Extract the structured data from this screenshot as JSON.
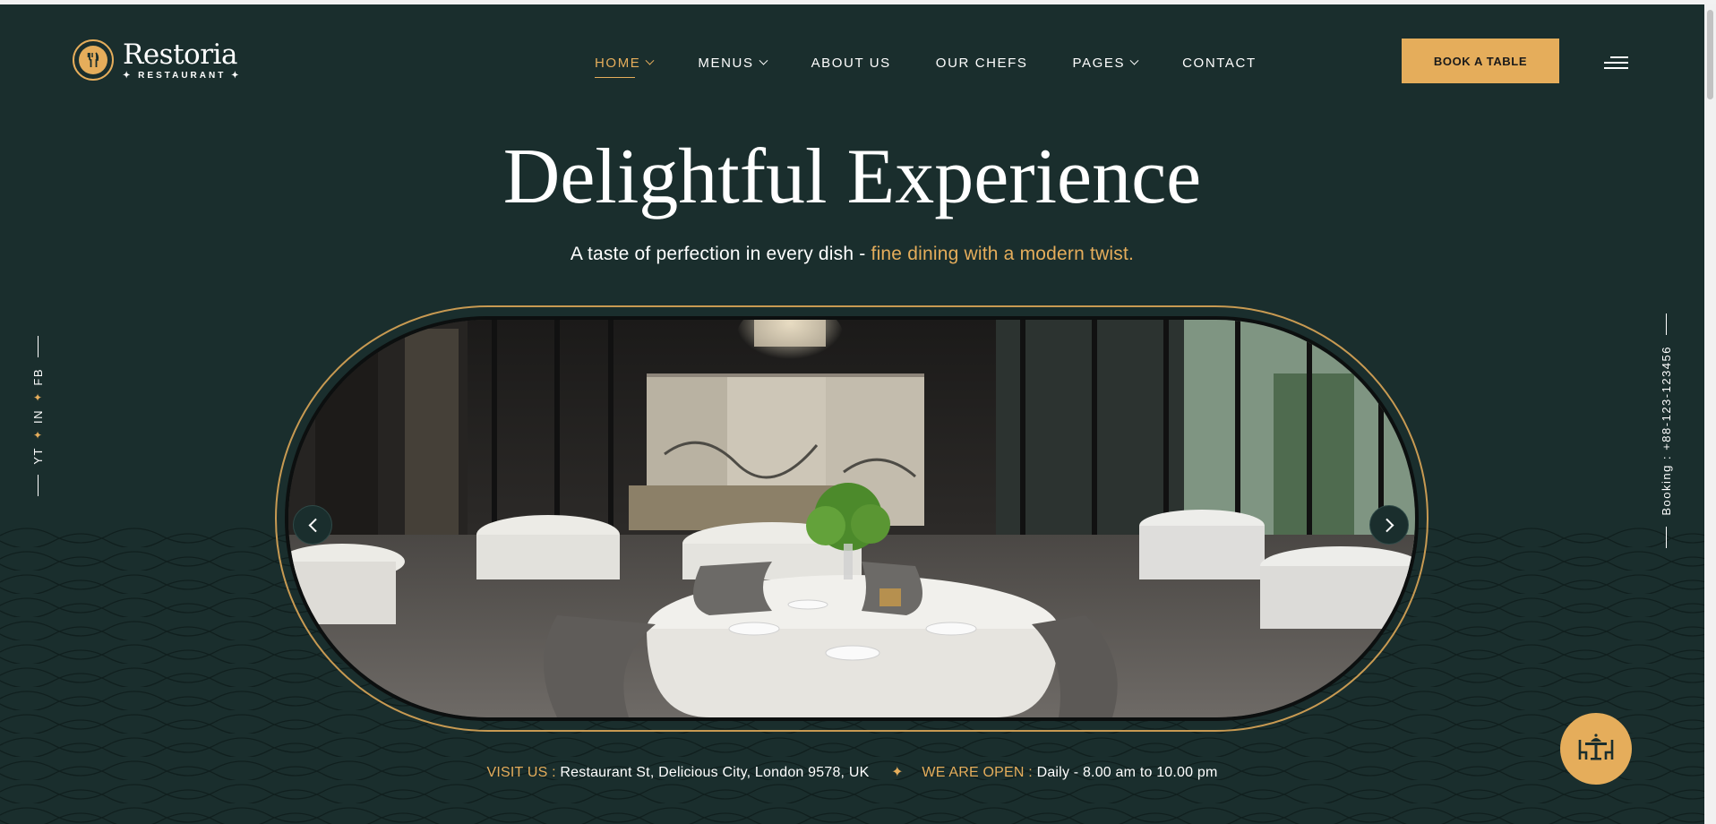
{
  "brand": {
    "name": "Restoria",
    "tagline": "RESTAURANT",
    "icon": "fork-knife-icon",
    "accent_color": "#e5ad5b",
    "background_color": "#1a2e2d"
  },
  "nav": {
    "items": [
      {
        "label": "HOME",
        "has_dropdown": true,
        "active": true
      },
      {
        "label": "MENUS",
        "has_dropdown": true
      },
      {
        "label": "ABOUT US"
      },
      {
        "label": "OUR CHEFS"
      },
      {
        "label": "PAGES",
        "has_dropdown": true
      },
      {
        "label": "CONTACT"
      }
    ],
    "cta": "BOOK A TABLE",
    "menu_icon": "hamburger-icon"
  },
  "hero": {
    "title": "Delightful Experience",
    "subtitle_plain": "A taste of perfection in every dish -",
    "subtitle_accent": "fine dining with a modern twist.",
    "image": "restaurant-dining-room-photo",
    "prev_icon": "chevron-left-icon",
    "next_icon": "chevron-right-icon"
  },
  "social": {
    "links": [
      "FB",
      "IN",
      "YT"
    ]
  },
  "booking": {
    "text": "Booking : +88-123-123456"
  },
  "info": {
    "visit_label": "VISIT US :",
    "visit_value": "Restaurant St, Delicious City, London 9578, UK",
    "open_label": "WE ARE OPEN :",
    "open_value": "Daily - 8.00 am to 10.00 pm"
  },
  "fab_icon": "dining-table-icon"
}
